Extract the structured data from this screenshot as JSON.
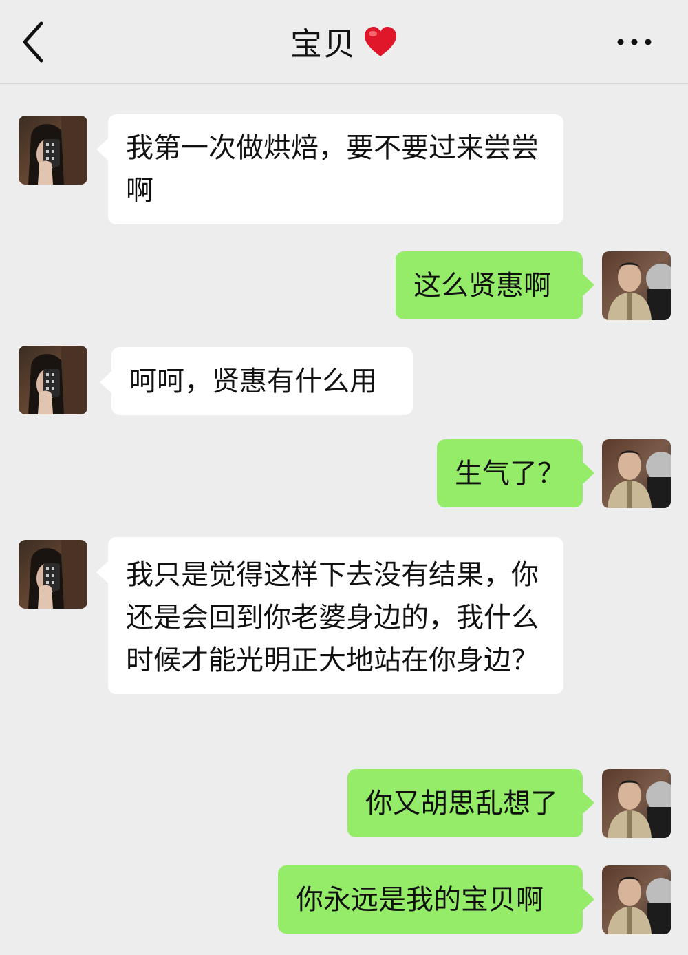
{
  "header": {
    "title": "宝贝",
    "back_icon": "chevron-left-icon",
    "emoji_icon": "red-heart-icon",
    "more_icon": "more-dots-icon"
  },
  "colors": {
    "background": "#ededed",
    "received_bubble": "#ffffff",
    "sent_bubble": "#95ec69",
    "heart": "#e0162b"
  },
  "messages": [
    {
      "sender": "contact",
      "text": "我第一次做烘焙，要不要过来尝尝啊"
    },
    {
      "sender": "me",
      "text": "这么贤惠啊"
    },
    {
      "sender": "contact",
      "text": "呵呵，贤惠有什么用"
    },
    {
      "sender": "me",
      "text": "生气了？"
    },
    {
      "sender": "contact",
      "text": "我只是觉得这样下去没有结果，你还是会回到你老婆身边的，我什么时候才能光明正大地站在你身边？"
    },
    {
      "sender": "me",
      "text": "你又胡思乱想了"
    },
    {
      "sender": "me",
      "text": "你永远是我的宝贝啊"
    }
  ]
}
